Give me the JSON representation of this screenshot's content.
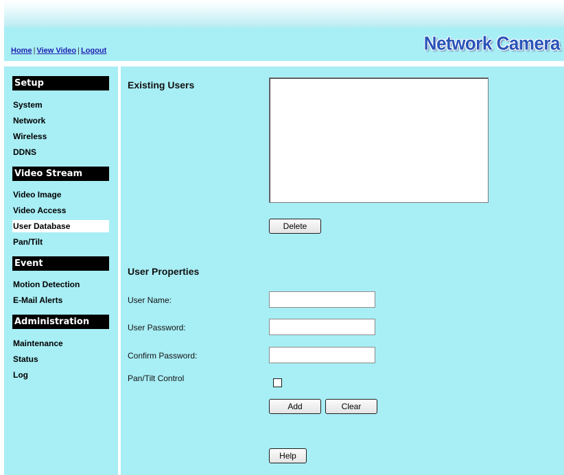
{
  "header": {
    "links": [
      "Home",
      "View Video",
      "Logout"
    ],
    "separator": "|",
    "logo": "Network Camera"
  },
  "sidebar": {
    "sections": [
      {
        "title": "Setup",
        "items": [
          "System",
          "Network",
          "Wireless",
          "DDNS"
        ]
      },
      {
        "title": "Video Stream",
        "items": [
          "Video Image",
          "Video Access",
          "User Database",
          "Pan/Tilt"
        ]
      },
      {
        "title": "Event",
        "items": [
          "Motion Detection",
          "E-Mail Alerts"
        ]
      },
      {
        "title": "Administration",
        "items": [
          "Maintenance",
          "Status",
          "Log"
        ]
      }
    ],
    "active_item": "User Database"
  },
  "main": {
    "existing_users_title": "Existing Users",
    "existing_users": [],
    "delete_label": "Delete",
    "user_properties_title": "User Properties",
    "user_name_label": "User Name:",
    "user_name_value": "",
    "user_password_label": "User Password:",
    "user_password_value": "",
    "confirm_password_label": "Confirm Password:",
    "confirm_password_value": "",
    "pantilt_label": "Pan/Tilt Control",
    "pantilt_checked": false,
    "add_label": "Add",
    "clear_label": "Clear",
    "help_label": "Help"
  },
  "colors": {
    "panel_bg": "#a8eef5",
    "logo": "#2a54b8",
    "link": "#2020b0",
    "section_header_bg": "#000000"
  }
}
